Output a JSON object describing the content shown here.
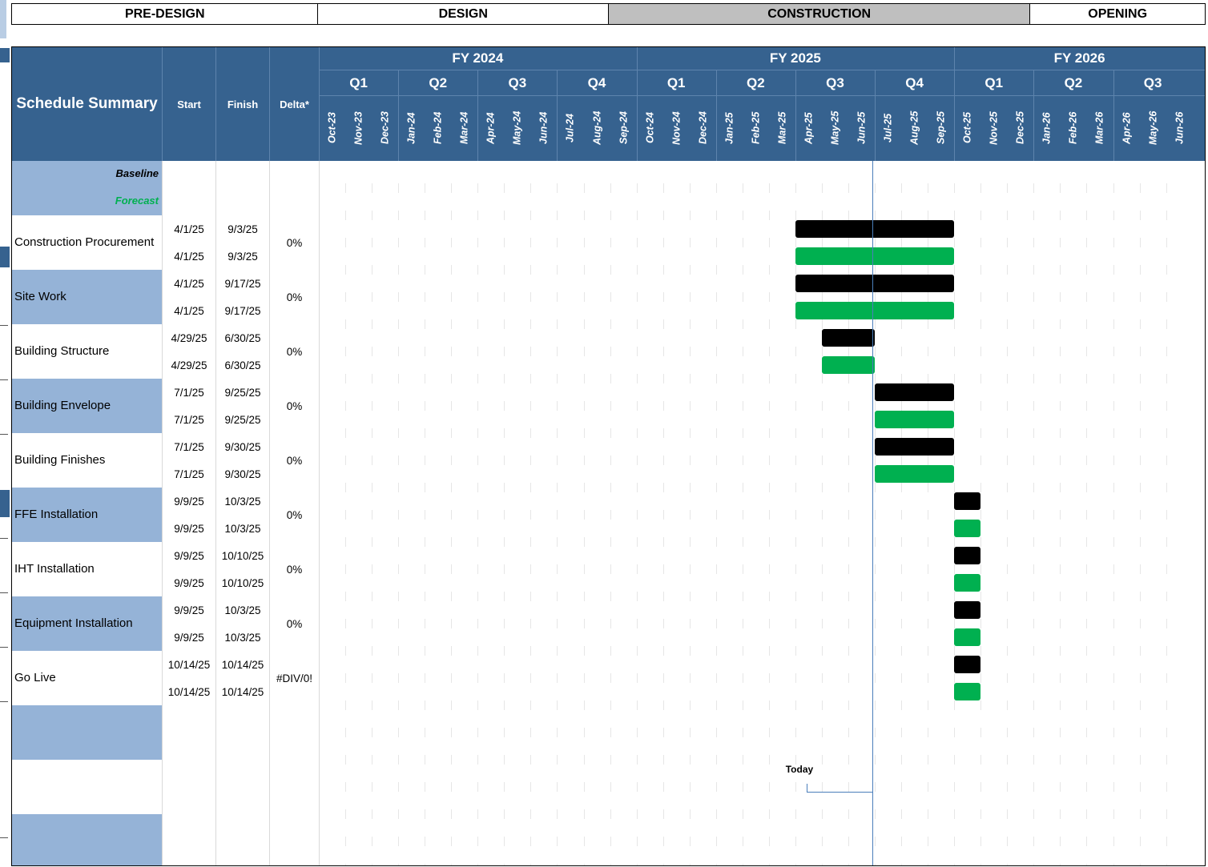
{
  "phases": [
    {
      "label": "PRE-DESIGN",
      "active": false
    },
    {
      "label": "DESIGN",
      "active": false
    },
    {
      "label": "CONSTRUCTION",
      "active": true
    },
    {
      "label": "OPENING",
      "active": false
    }
  ],
  "header": {
    "title": "Schedule Summary",
    "start": "Start",
    "finish": "Finish",
    "delta": "Delta*"
  },
  "fiscal_years": [
    "FY 2024",
    "FY 2025",
    "FY 2026"
  ],
  "quarters": [
    "Q1",
    "Q2",
    "Q3",
    "Q4",
    "Q1",
    "Q2",
    "Q3",
    "Q4",
    "Q1",
    "Q2",
    "Q3"
  ],
  "months": [
    "Oct-23",
    "Nov-23",
    "Dec-23",
    "Jan-24",
    "Feb-24",
    "Mar-24",
    "Apr-24",
    "May-24",
    "Jun-24",
    "Jul-24",
    "Aug-24",
    "Sep-24",
    "Oct-24",
    "Nov-24",
    "Dec-24",
    "Jan-25",
    "Feb-25",
    "Mar-25",
    "Apr-25",
    "May-25",
    "Jun-25",
    "Jul-25",
    "Aug-25",
    "Sep-25",
    "Oct-25",
    "Nov-25",
    "Dec-25",
    "Jan-26",
    "Feb-26",
    "Mar-26",
    "Apr-26",
    "May-26",
    "Jun-26"
  ],
  "legend": {
    "baseline": "Baseline",
    "forecast": "Forecast"
  },
  "colors": {
    "header": "#36628f",
    "band": "#95b3d7",
    "baseline": "#000000",
    "forecast": "#00b050",
    "today": "#4a7ebb",
    "active_phase": "#bfbfbf"
  },
  "tasks": [
    {
      "name": "Construction Procurement",
      "baseline_start": "4/1/25",
      "baseline_finish": "9/3/25",
      "forecast_start": "4/1/25",
      "forecast_finish": "9/3/25",
      "delta": "0%",
      "bar_months": [
        18,
        24
      ],
      "banded": false
    },
    {
      "name": "Site Work",
      "baseline_start": "4/1/25",
      "baseline_finish": "9/17/25",
      "forecast_start": "4/1/25",
      "forecast_finish": "9/17/25",
      "delta": "0%",
      "bar_months": [
        18,
        24
      ],
      "banded": true
    },
    {
      "name": "Building Structure",
      "baseline_start": "4/29/25",
      "baseline_finish": "6/30/25",
      "forecast_start": "4/29/25",
      "forecast_finish": "6/30/25",
      "delta": "0%",
      "bar_months": [
        19,
        21
      ],
      "banded": false
    },
    {
      "name": "Building Envelope",
      "baseline_start": "7/1/25",
      "baseline_finish": "9/25/25",
      "forecast_start": "7/1/25",
      "forecast_finish": "9/25/25",
      "delta": "0%",
      "bar_months": [
        21,
        24
      ],
      "banded": true
    },
    {
      "name": "Building Finishes",
      "baseline_start": "7/1/25",
      "baseline_finish": "9/30/25",
      "forecast_start": "7/1/25",
      "forecast_finish": "9/30/25",
      "delta": "0%",
      "bar_months": [
        21,
        24
      ],
      "banded": false
    },
    {
      "name": "FFE Installation",
      "baseline_start": "9/9/25",
      "baseline_finish": "10/3/25",
      "forecast_start": "9/9/25",
      "forecast_finish": "10/3/25",
      "delta": "0%",
      "bar_months": [
        24,
        25
      ],
      "banded": true
    },
    {
      "name": "IHT Installation",
      "baseline_start": "9/9/25",
      "baseline_finish": "10/10/25",
      "forecast_start": "9/9/25",
      "forecast_finish": "10/10/25",
      "delta": "0%",
      "bar_months": [
        24,
        25
      ],
      "banded": false
    },
    {
      "name": "Equipment Installation",
      "baseline_start": "9/9/25",
      "baseline_finish": "10/3/25",
      "forecast_start": "9/9/25",
      "forecast_finish": "10/3/25",
      "delta": "0%",
      "bar_months": [
        24,
        25
      ],
      "banded": true
    },
    {
      "name": "Go Live",
      "baseline_start": "10/14/25",
      "baseline_finish": "10/14/25",
      "forecast_start": "10/14/25",
      "forecast_finish": "10/14/25",
      "delta": "#DIV/0!",
      "bar_months": [
        24,
        25
      ],
      "banded": false
    }
  ],
  "empty_bands": [
    true,
    false,
    true
  ],
  "today": {
    "label": "Today",
    "month_fraction": 20.9
  }
}
